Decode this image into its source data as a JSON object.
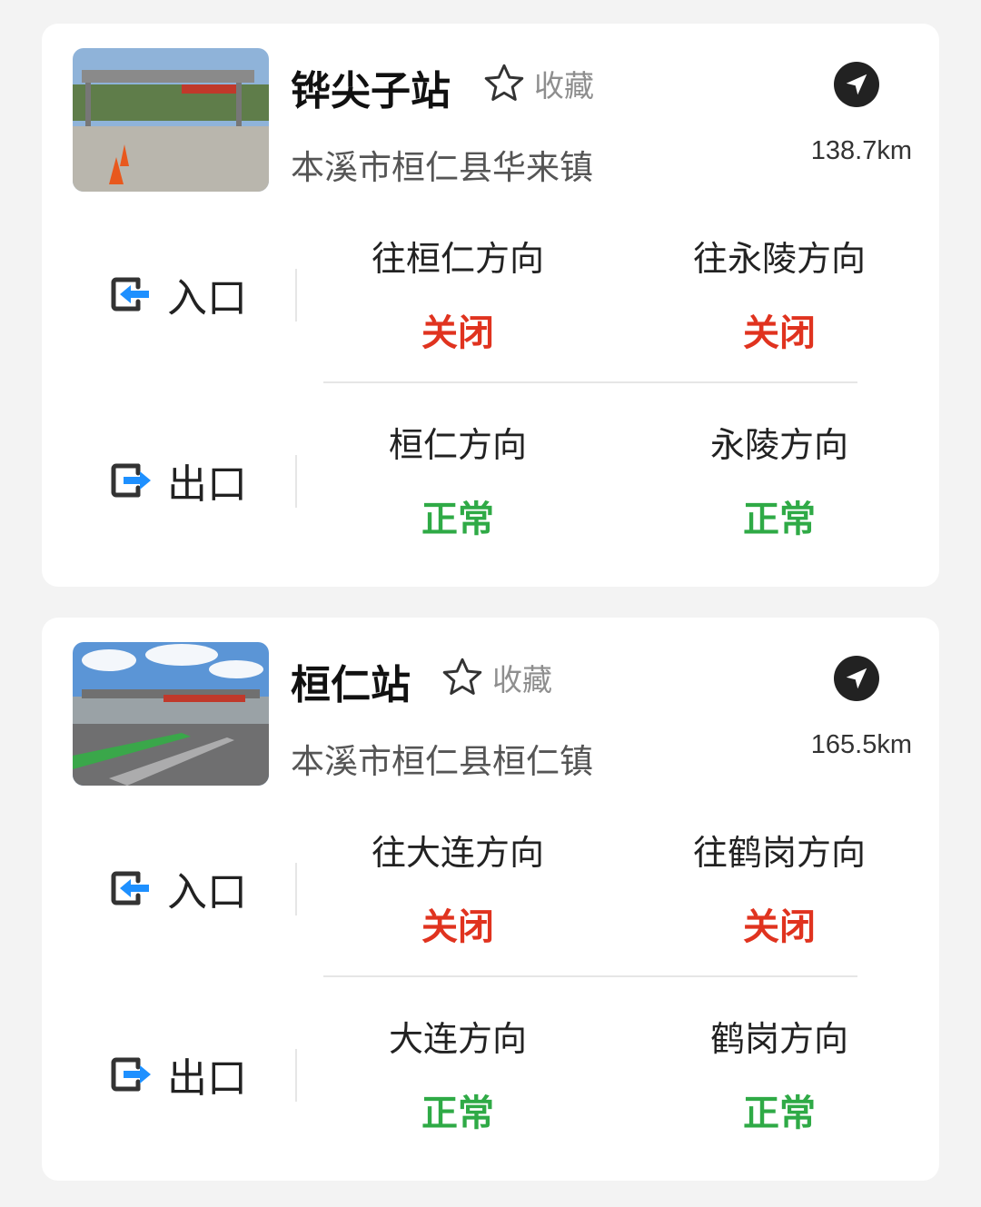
{
  "colors": {
    "closed": "#e0331f",
    "normal": "#2faa46",
    "icon_blue": "#1e90ff"
  },
  "stations": [
    {
      "name": "铧尖子站",
      "favorite_label": "收藏",
      "address": "本溪市桓仁县华来镇",
      "distance": "138.7km",
      "entrance": {
        "label": "入口",
        "directions": [
          {
            "name": "往桓仁方向",
            "status": "关闭"
          },
          {
            "name": "往永陵方向",
            "status": "关闭"
          }
        ]
      },
      "exit": {
        "label": "出口",
        "directions": [
          {
            "name": "桓仁方向",
            "status": "正常"
          },
          {
            "name": "永陵方向",
            "status": "正常"
          }
        ]
      }
    },
    {
      "name": "桓仁站",
      "favorite_label": "收藏",
      "address": "本溪市桓仁县桓仁镇",
      "distance": "165.5km",
      "entrance": {
        "label": "入口",
        "directions": [
          {
            "name": "往大连方向",
            "status": "关闭"
          },
          {
            "name": "往鹤岗方向",
            "status": "关闭"
          }
        ]
      },
      "exit": {
        "label": "出口",
        "directions": [
          {
            "name": "大连方向",
            "status": "正常"
          },
          {
            "name": "鹤岗方向",
            "status": "正常"
          }
        ]
      }
    }
  ]
}
